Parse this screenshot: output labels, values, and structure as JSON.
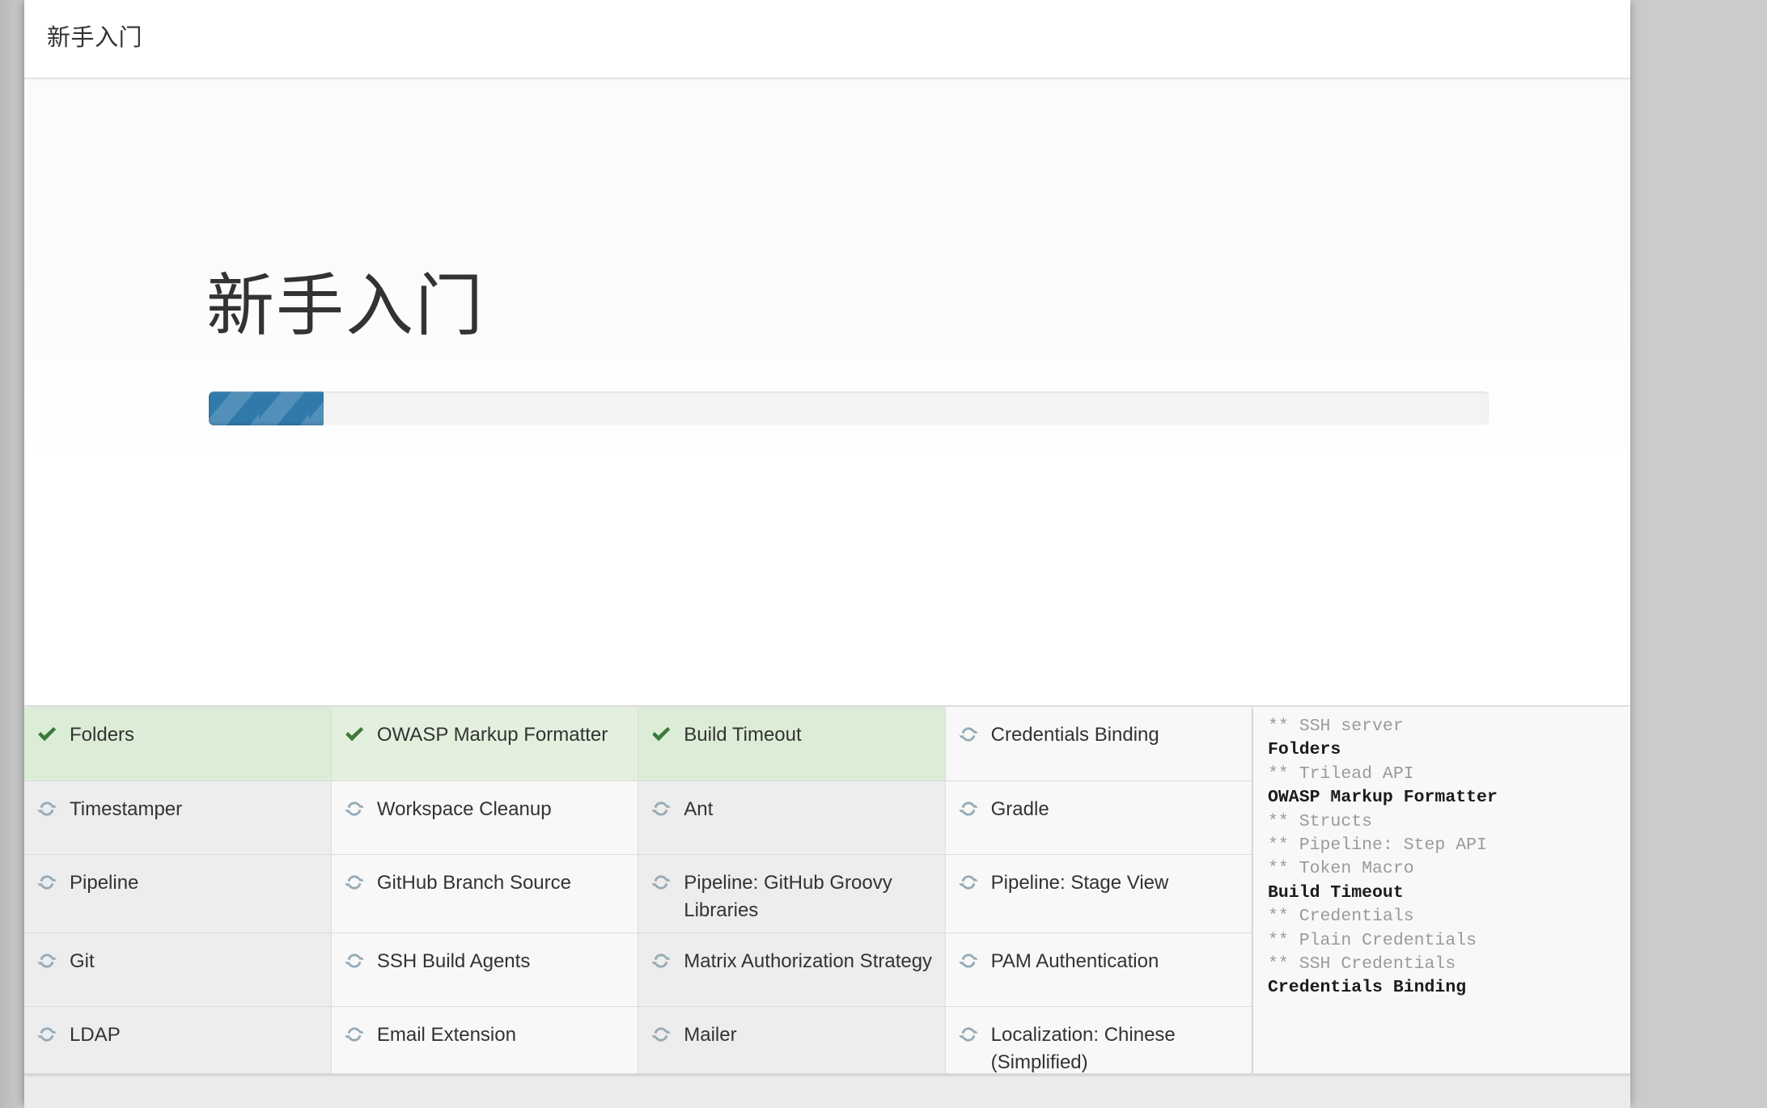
{
  "window": {
    "backdrop_color": "#c9c9c9",
    "modal_background": "#fafafa"
  },
  "header": {
    "title": "新手入门"
  },
  "hero": {
    "heading": "新手入门"
  },
  "progress": {
    "percent": 9,
    "fill_color": "#3079ab",
    "stripe_color": "#4a90c4",
    "track_color": "#f3f3f3"
  },
  "status_colors": {
    "success_background": "#dcedd7",
    "success_check": "#3c7a3c",
    "pending_spinner": "#93a8b5"
  },
  "plugin_grid": {
    "columns": 4,
    "rows": [
      [
        {
          "name": "Folders",
          "status": "success"
        },
        {
          "name": "OWASP Markup Formatter",
          "status": "success"
        },
        {
          "name": "Build Timeout",
          "status": "success"
        },
        {
          "name": "Credentials Binding",
          "status": "pending"
        }
      ],
      [
        {
          "name": "Timestamper",
          "status": "pending"
        },
        {
          "name": "Workspace Cleanup",
          "status": "pending"
        },
        {
          "name": "Ant",
          "status": "pending"
        },
        {
          "name": "Gradle",
          "status": "pending"
        }
      ],
      [
        {
          "name": "Pipeline",
          "status": "pending"
        },
        {
          "name": "GitHub Branch Source",
          "status": "pending"
        },
        {
          "name": "Pipeline: GitHub Groovy Libraries",
          "status": "pending"
        },
        {
          "name": "Pipeline: Stage View",
          "status": "pending"
        }
      ],
      [
        {
          "name": "Git",
          "status": "pending"
        },
        {
          "name": "SSH Build Agents",
          "status": "pending"
        },
        {
          "name": "Matrix Authorization Strategy",
          "status": "pending"
        },
        {
          "name": "PAM Authentication",
          "status": "pending"
        }
      ],
      [
        {
          "name": "LDAP",
          "status": "pending"
        },
        {
          "name": "Email Extension",
          "status": "pending"
        },
        {
          "name": "Mailer",
          "status": "pending"
        },
        {
          "name": "Localization: Chinese (Simplified)",
          "status": "pending"
        }
      ]
    ]
  },
  "install_log": {
    "lines": [
      {
        "text": "** SSH server",
        "kind": "dep"
      },
      {
        "text": "Folders",
        "kind": "main"
      },
      {
        "text": "** Trilead API",
        "kind": "dep"
      },
      {
        "text": "OWASP Markup Formatter",
        "kind": "main"
      },
      {
        "text": "** Structs",
        "kind": "dep"
      },
      {
        "text": "** Pipeline: Step API",
        "kind": "dep"
      },
      {
        "text": "** Token Macro",
        "kind": "dep"
      },
      {
        "text": "Build Timeout",
        "kind": "main"
      },
      {
        "text": "** Credentials",
        "kind": "dep"
      },
      {
        "text": "** Plain Credentials",
        "kind": "dep"
      },
      {
        "text": "** SSH Credentials",
        "kind": "dep"
      },
      {
        "text": "Credentials Binding",
        "kind": "main"
      }
    ]
  }
}
